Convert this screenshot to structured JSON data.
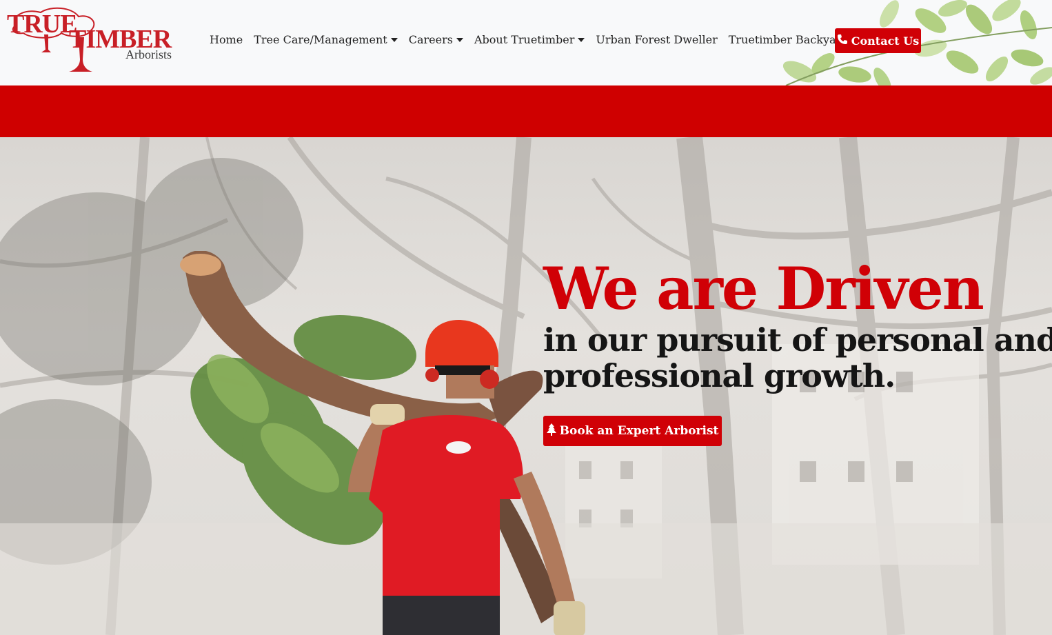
{
  "brand": {
    "logo_word_1": "TRUE",
    "logo_word_2": "TIMBER",
    "logo_sub": "Arborists",
    "primary_color": "#d00006",
    "nav_text_color": "#222222"
  },
  "nav": {
    "items": [
      {
        "label": "Home",
        "dropdown": false
      },
      {
        "label": "Tree Care/Management",
        "dropdown": true
      },
      {
        "label": "Careers",
        "dropdown": true
      },
      {
        "label": "About Truetimber",
        "dropdown": true
      },
      {
        "label": "Urban Forest Dweller",
        "dropdown": false
      },
      {
        "label": "Truetimber Backyard",
        "dropdown": false
      }
    ],
    "contact_label": "Contact Us",
    "contact_icon": "phone-icon"
  },
  "hero": {
    "title": "We are Driven",
    "subtitle": "in our pursuit of personal and professional growth.",
    "cta_label": "Book an Expert Arborist",
    "cta_icon": "tree-icon"
  }
}
